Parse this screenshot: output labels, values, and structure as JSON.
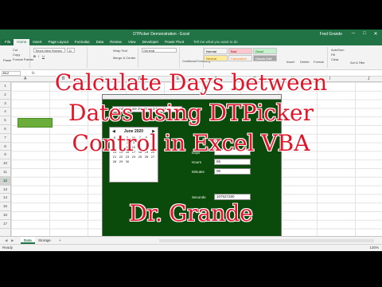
{
  "app": {
    "window_title": "DTPicker Demonstration - Excel",
    "user": "Fred Grande",
    "window_buttons": [
      "─",
      "□",
      "✕"
    ]
  },
  "ribbon": {
    "tabs": [
      "File",
      "Home",
      "Insert",
      "Page Layout",
      "Formulas",
      "Data",
      "Review",
      "View",
      "Developer",
      "Power Pivot"
    ],
    "active_tab": "Home",
    "tell_me": "Tell me what you want to do",
    "font_name": "Times New Roman",
    "font_size": "11",
    "number_format": "General",
    "clipboard_items": [
      "Cut",
      "Copy",
      "Format Painter"
    ],
    "paste_label": "Paste",
    "alignment_items": [
      "Wrap Text",
      "Merge & Center"
    ],
    "conditional_label": "Conditional Formatting",
    "format_table_label": "Format as Table",
    "styles": [
      {
        "label": "Normal",
        "bg": "#ffffff",
        "color": "#000000"
      },
      {
        "label": "Bad",
        "bg": "#ffc7ce",
        "color": "#9c0006"
      },
      {
        "label": "Good",
        "bg": "#c6efce",
        "color": "#006100"
      },
      {
        "label": "Neutral",
        "bg": "#ffeb9c",
        "color": "#9c6500"
      },
      {
        "label": "Calculation",
        "bg": "#f2f2f2",
        "color": "#fa7d00"
      },
      {
        "label": "Check Cell",
        "bg": "#a5a5a5",
        "color": "#ffffff"
      }
    ],
    "cells_items": [
      "Insert",
      "Delete",
      "Format"
    ],
    "editing_items": [
      "AutoSum",
      "Fill",
      "Clear",
      "Sort & Filter",
      "Find & Select"
    ]
  },
  "formula_bar": {
    "name_box": "B12",
    "fx": "fx"
  },
  "columns": [
    "A",
    "B",
    "C",
    "D",
    "E",
    "F",
    "G",
    "H",
    "I",
    "J"
  ],
  "rows": [
    "1",
    "2",
    "3",
    "4",
    "5",
    "6",
    "7",
    "8",
    "9",
    "10",
    "11",
    "12",
    "13",
    "14",
    "15",
    "16",
    "17"
  ],
  "selected_row": "12",
  "form": {
    "dtp_value": "Monday, June 20, 2016 2:00 AM",
    "calendar": {
      "month": "June 2020",
      "days": [
        "S",
        "M",
        "T",
        "W",
        "T",
        "F",
        "S"
      ],
      "dates": [
        "",
        "1",
        "2",
        "3",
        "4",
        "5",
        "6",
        "7",
        "8",
        "9",
        "10",
        "11",
        "12",
        "13",
        "14",
        "15",
        "16",
        "17",
        "18",
        "19",
        "20",
        "21",
        "22",
        "23",
        "24",
        "25",
        "26",
        "27",
        "28",
        "29",
        "30",
        "",
        "",
        "",
        "",
        ""
      ]
    },
    "fields": [
      {
        "label": "Days",
        "value": ""
      },
      {
        "label": "Hours",
        "value": "65"
      },
      {
        "label": "Minutes",
        "value": "06"
      },
      {
        "label": "Seconds",
        "value": "107627280"
      }
    ]
  },
  "sheets": {
    "tabs": [
      "Data",
      "Storage"
    ],
    "active": "Data",
    "add": "+"
  },
  "status": {
    "ready": "Ready",
    "zoom": "130%"
  },
  "overlay": {
    "title_lines": [
      "Calculate Days between",
      "Dates using DTPicker",
      "Control in Excel VBA"
    ],
    "author": "Dr. Grande"
  }
}
